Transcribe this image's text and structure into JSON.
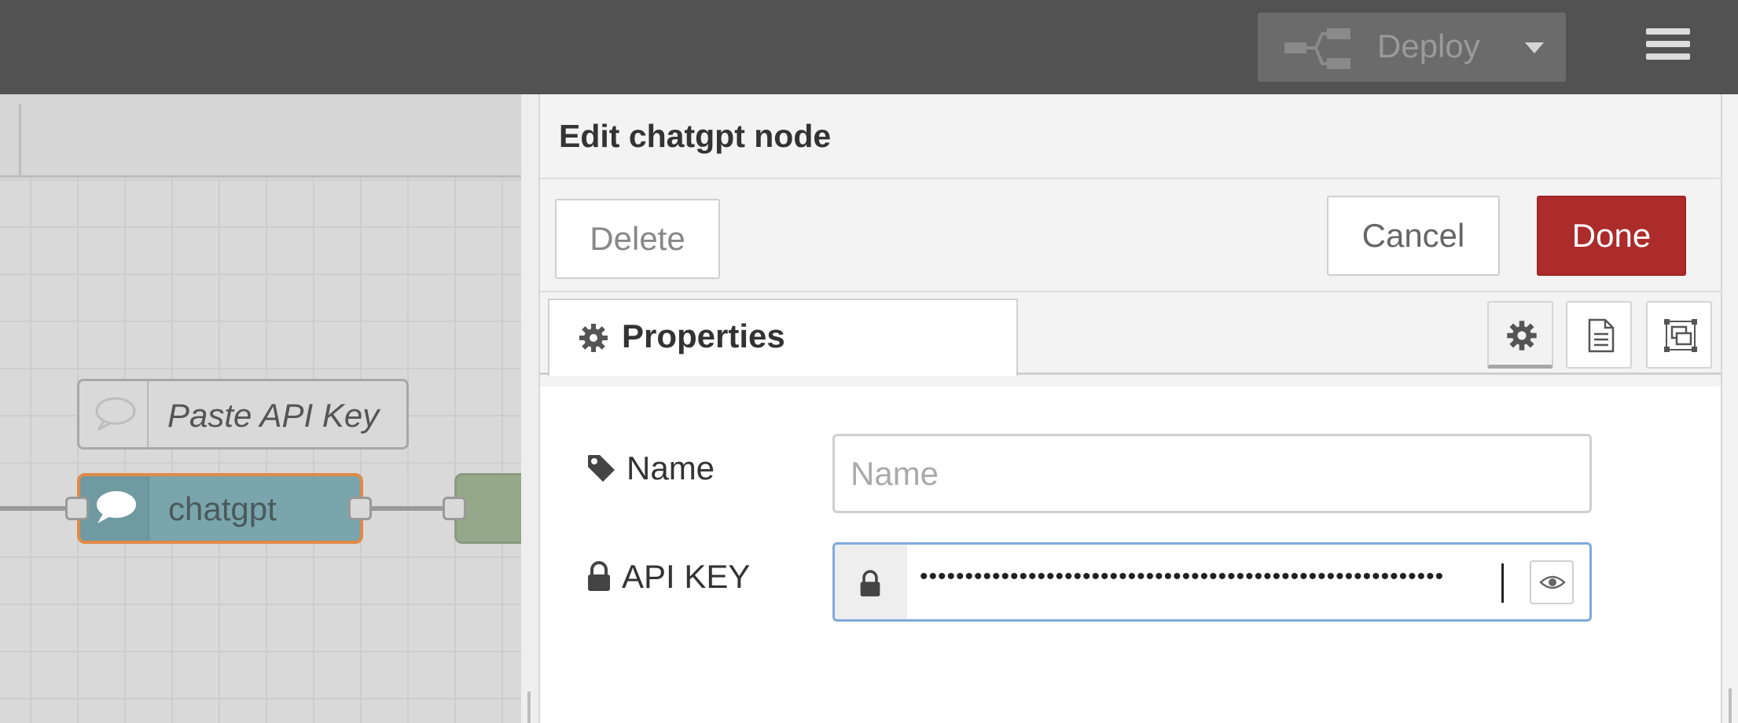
{
  "header": {
    "deploy_label": "Deploy",
    "deploy_icon": "deploy-flow-icon",
    "menu_icon": "hamburger-menu-icon"
  },
  "workspace": {
    "comment_node": {
      "label": "Paste API Key",
      "icon": "comment-bubble-icon"
    },
    "chatgpt_node": {
      "label": "chatgpt",
      "icon": "chat-bubble-icon"
    }
  },
  "editor": {
    "title": "Edit chatgpt node",
    "delete_label": "Delete",
    "cancel_label": "Cancel",
    "done_label": "Done",
    "tabs": {
      "properties_label": "Properties",
      "icon_tabs": [
        "settings-gear-icon",
        "description-doc-icon",
        "appearance-frame-icon"
      ]
    },
    "form": {
      "name_label": "Name",
      "name_placeholder": "Name",
      "name_value": "",
      "apikey_label": "API KEY",
      "apikey_masked": "••••••••••••••••••••••••••••••••••••••••••••••••••••••••••"
    }
  },
  "colors": {
    "header_bg": "#525252",
    "done_bg": "#ac2b2b",
    "node_selected_border": "#e08a47",
    "chatgpt_node_bg": "#7aa5ac",
    "focus_border": "#7fa9dc"
  }
}
